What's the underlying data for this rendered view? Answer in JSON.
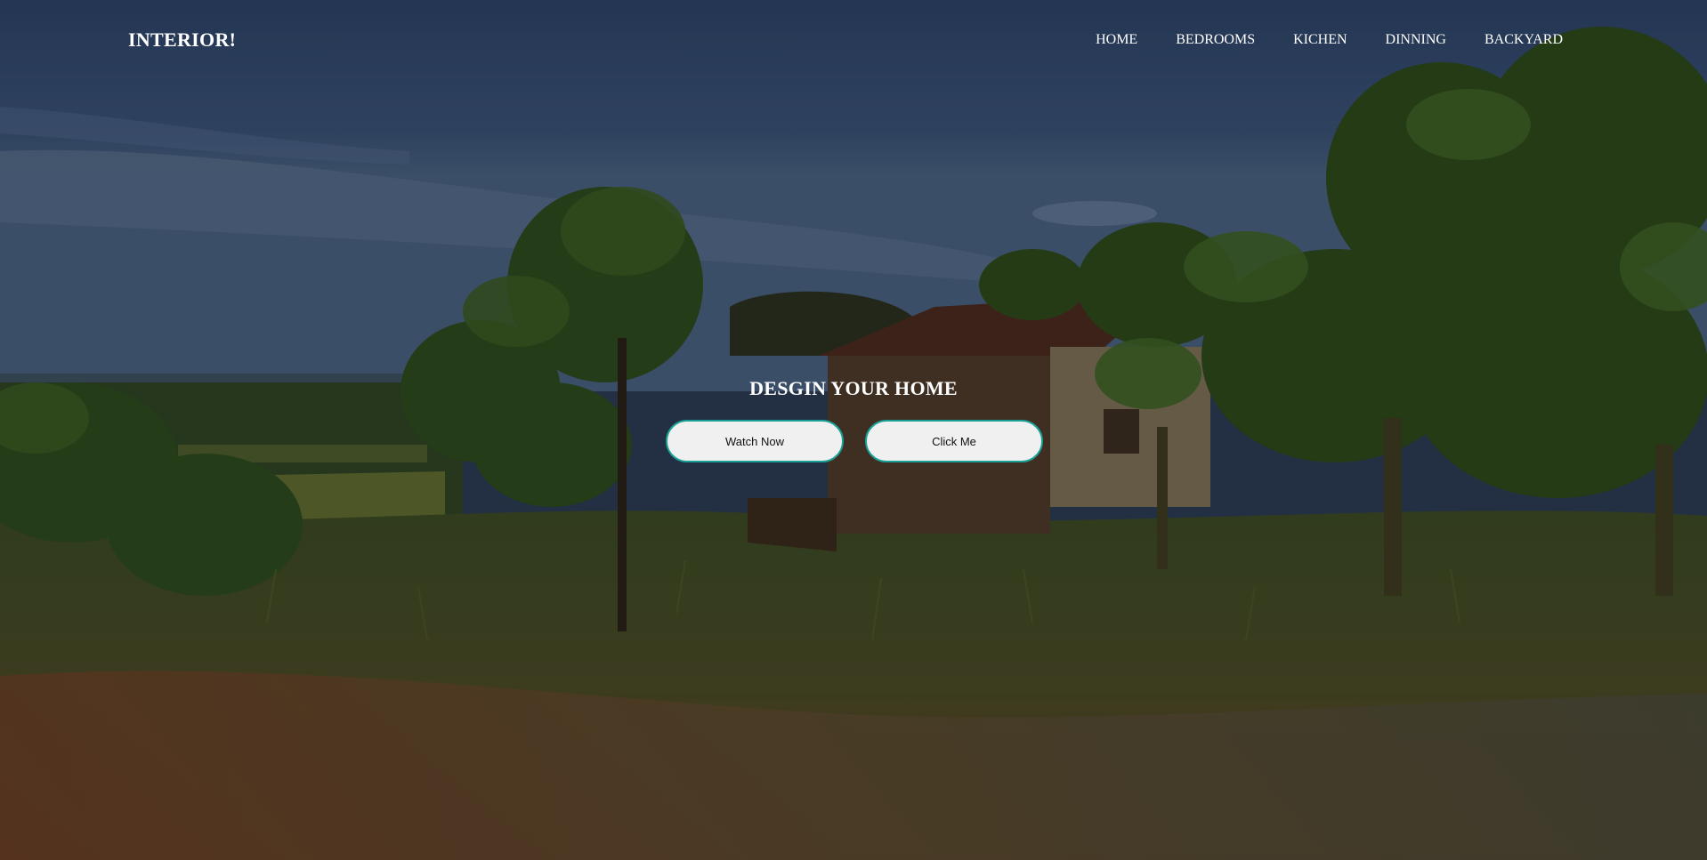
{
  "brand": {
    "logo_text": "INTERIOR!"
  },
  "nav": {
    "items": [
      {
        "label": "HOME"
      },
      {
        "label": "BEDROOMS"
      },
      {
        "label": "KICHEN"
      },
      {
        "label": "DINNING"
      },
      {
        "label": "BACKYARD"
      }
    ]
  },
  "hero": {
    "title": "DESGIN YOUR HOME",
    "buttons": [
      {
        "label": "Watch Now"
      },
      {
        "label": "Click Me"
      }
    ],
    "background_image": "landscape-with-wooden-hut-and-banana-trees",
    "button_border_color": "#1aa195",
    "button_bg_color": "#f0f0f0"
  }
}
